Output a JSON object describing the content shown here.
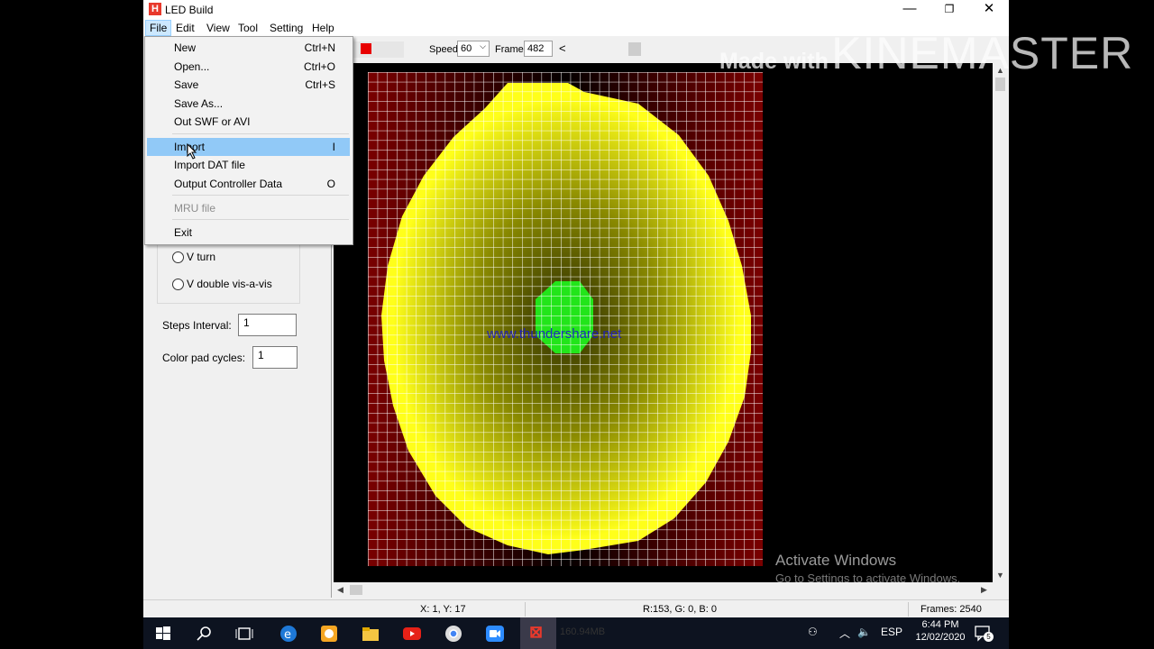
{
  "window": {
    "title": "LED Build",
    "app_icon": "H",
    "controls": {
      "minimize": "—",
      "restore": "❐",
      "close": "✕"
    }
  },
  "menubar": [
    "File",
    "Edit",
    "View",
    "Tool",
    "Setting",
    "Help"
  ],
  "toolbar": {
    "speed_label": "Speed:",
    "speed_value": "60",
    "frame_label": "Frame:",
    "frame_value": "482",
    "prev_label": "<",
    "color_swatch": "#e80000"
  },
  "left_panel": {
    "options": [
      "V turn",
      "V double vis-a-vis"
    ],
    "steps_interval_label": "Steps Interval:",
    "steps_interval_value": "1",
    "color_pad_cycles_label": "Color pad cycles:",
    "color_pad_cycles_value": "1"
  },
  "file_menu": {
    "items": [
      {
        "label": "New",
        "shortcut": "Ctrl+N"
      },
      {
        "label": "Open...",
        "shortcut": "Ctrl+O"
      },
      {
        "label": "Save",
        "shortcut": "Ctrl+S"
      },
      {
        "label": "Save As...",
        "shortcut": ""
      },
      {
        "label": "Out SWF or AVI",
        "shortcut": ""
      },
      {
        "label": "Import",
        "shortcut": "I",
        "highlighted": true
      },
      {
        "label": "Import DAT file",
        "shortcut": ""
      },
      {
        "label": "Output Controller Data",
        "shortcut": "O"
      },
      {
        "label": "MRU file",
        "shortcut": "",
        "disabled": true
      },
      {
        "label": "Exit",
        "shortcut": ""
      }
    ]
  },
  "canvas": {
    "watermark_url": "www.thundershare.net",
    "colors": {
      "yellow": "#ffff1a",
      "green": "#22e51a",
      "red": "#8b0000",
      "grid": "#ffffff"
    },
    "activate_title": "Activate Windows",
    "activate_sub": "Go to Settings to activate Windows."
  },
  "statusbar": {
    "coords": "X: 1, Y: 17",
    "rgb": "R:153, G: 0, B: 0",
    "frames": "Frames: 2540"
  },
  "overlay": {
    "made_with": "Made with",
    "brand": "KINEMASTER"
  },
  "taskbar": {
    "time": "6:44 PM",
    "date": "12/02/2020",
    "lang": "ESP",
    "notification_count": "5",
    "ghost_text": "160.94MB"
  }
}
